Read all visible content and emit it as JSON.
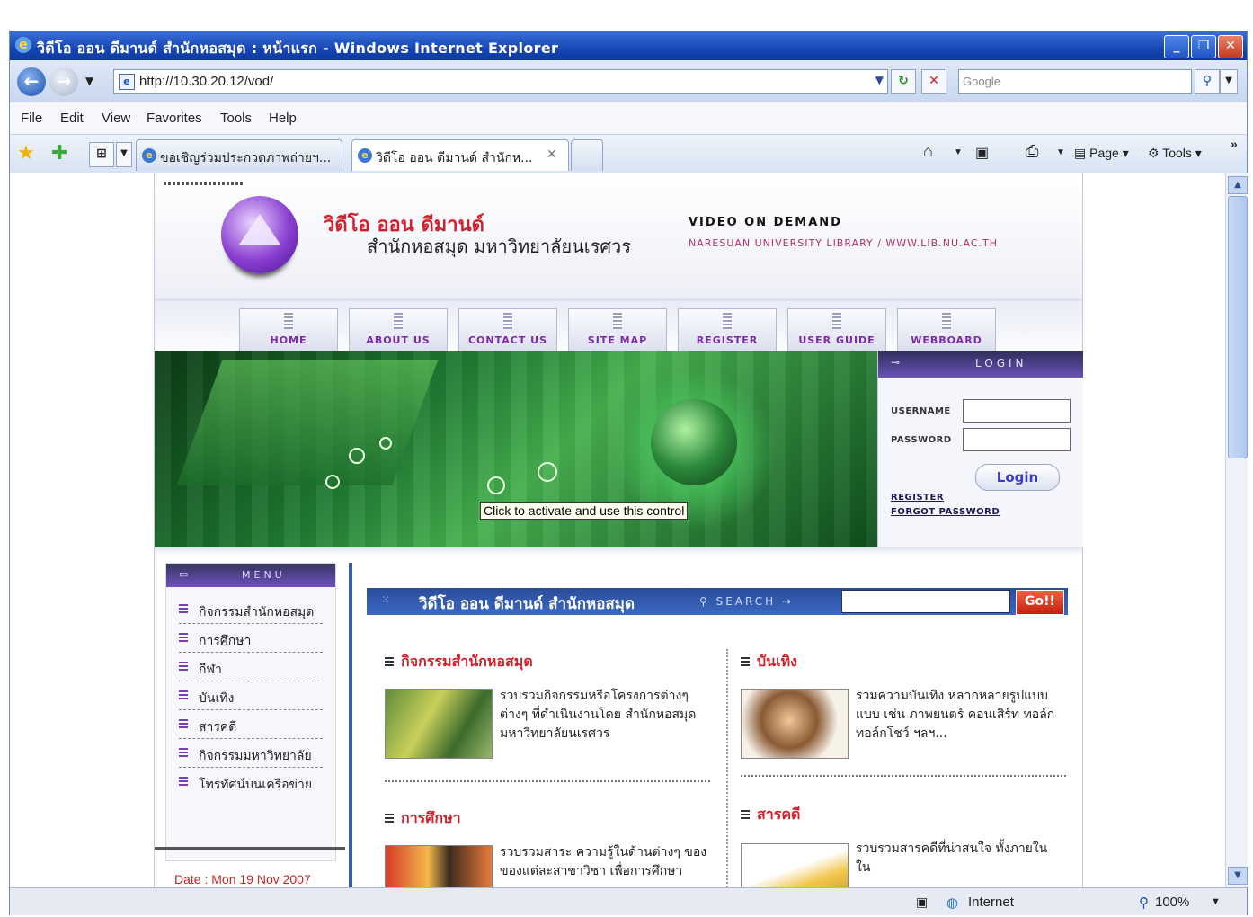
{
  "window": {
    "title": "วิดีโอ ออน ดีมานด์ สำนักหอสมุด : หน้าแรก - Windows Internet Explorer"
  },
  "address": {
    "url": "http://10.30.20.12/vod/",
    "search_placeholder": "Google"
  },
  "menu": [
    "File",
    "Edit",
    "View",
    "Favorites",
    "Tools",
    "Help"
  ],
  "tabs": [
    {
      "label": "ขอเชิญร่วมประกวดภาพถ่ายฯ...",
      "active": false
    },
    {
      "label": "วิดีโอ ออน ดีมานด์ สำนักห...",
      "active": true
    }
  ],
  "commands": {
    "page": "Page",
    "tools": "Tools"
  },
  "header": {
    "title_th": "วิดีโอ ออน ดีมานด์",
    "subtitle_th": "สำนักหอสมุด มหาวิทยาลัยนเรศวร",
    "title_en": "VIDEO ON DEMAND",
    "subtitle_en": "NARESUAN UNIVERSITY LIBRARY / WWW.LIB.NU.AC.TH"
  },
  "nav": [
    "HOME",
    "ABOUT US",
    "CONTACT US",
    "SITE MAP",
    "REGISTER",
    "USER GUIDE",
    "WEBBOARD"
  ],
  "banner": {
    "tooltip": "Click to activate and use this control"
  },
  "login": {
    "header": "LOGIN",
    "username_label": "USERNAME",
    "password_label": "PASSWORD",
    "button": "Login",
    "register_link": "REGISTER",
    "forgot_link": "FORGOT PASSWORD"
  },
  "sidebar": {
    "header": "MENU",
    "items": [
      "กิจกรรมสำนักหอสมุด",
      "การศึกษา",
      "กีฬา",
      "บันเทิง",
      "สารคดี",
      "กิจกรรมมหาวิทยาลัย",
      "โทรทัศน์บนเครือข่าย"
    ],
    "date": "Date : Mon 19 Nov 2007"
  },
  "main": {
    "title": "วิดีโอ ออน ดีมานด์ สำนักหอสมุด",
    "search_label": "SEARCH",
    "go_label": "Go!!",
    "sections": [
      {
        "heading": "กิจกรรมสำนักหอสมุด",
        "desc": "รวบรวมกิจกรรมหรือโครงการต่างๆ ต่างๆ ที่ดำเนินงานโดย สำนักหอสมุด มหาวิทยาลัยนเรศวร"
      },
      {
        "heading": "บันเทิง",
        "desc": "รวมความบันเทิง หลากหลายรูปแบบ แบบ เช่น ภาพยนตร์ คอนเสิร์ท ทอล์ก ทอล์กโชว์ ฯลฯ..."
      },
      {
        "heading": "การศึกษา",
        "desc": "รวบรวมสาระ ความรู้ในด้านต่างๆ ของ ของแต่ละสาขาวิชา เพื่อการศึกษา"
      },
      {
        "heading": "สารคดี",
        "desc": "รวบรวมสารคดีที่น่าสนใจ ทั้งภายใน ใน"
      }
    ]
  },
  "status": {
    "zone": "Internet",
    "zoom": "100%"
  }
}
